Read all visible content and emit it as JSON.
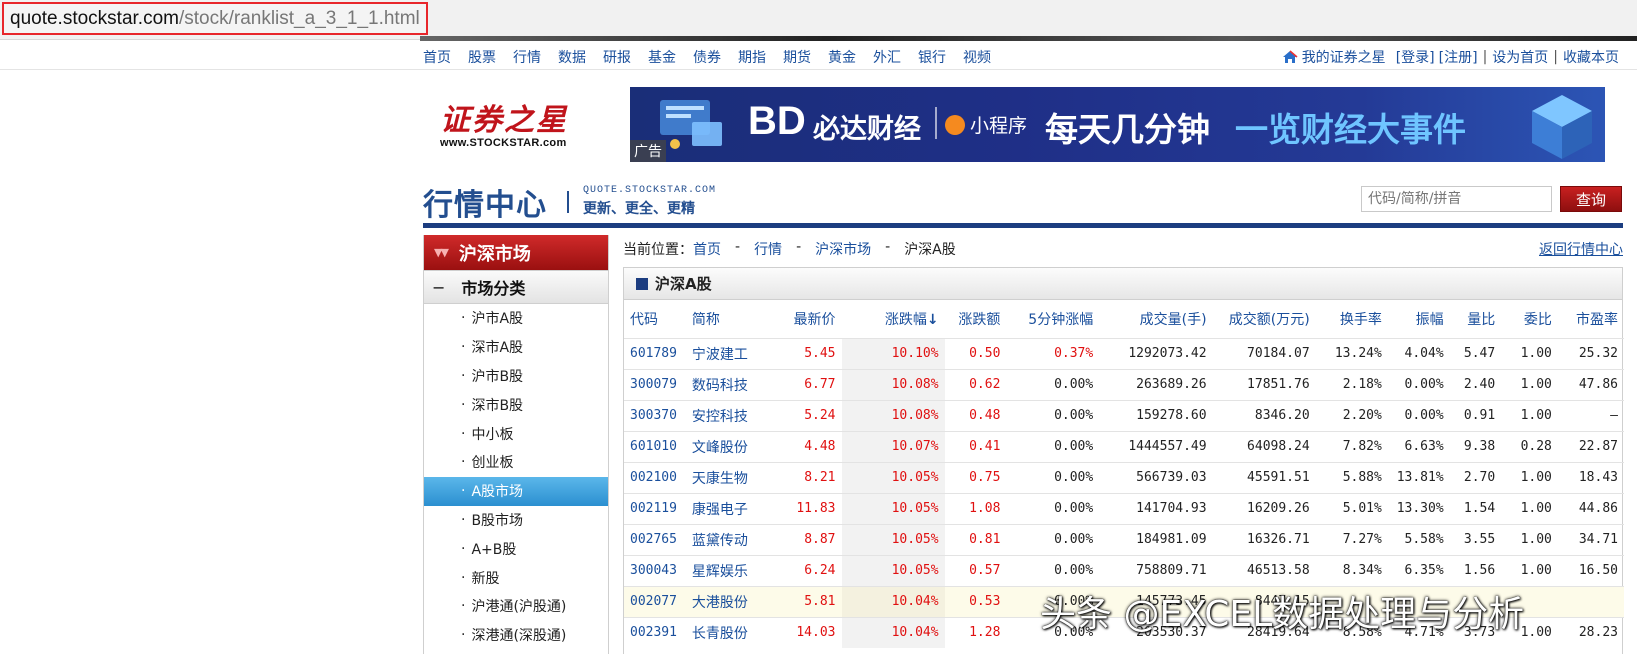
{
  "url": {
    "host": "quote.stockstar.com",
    "path": "/stock/ranklist_a_3_1_1.html"
  },
  "topnav": {
    "links": [
      "首页",
      "股票",
      "行情",
      "数据",
      "研报",
      "基金",
      "债券",
      "期指",
      "期货",
      "黄金",
      "外汇",
      "银行",
      "视频"
    ],
    "right": {
      "my": "我的证券之星",
      "login": "[登录]",
      "register": "[注册]",
      "sep": "|",
      "set_home": "设为首页",
      "favorite": "收藏本页"
    }
  },
  "logo": {
    "cn": "证券之星",
    "en": "www.STOCKSTAR.com"
  },
  "banner": {
    "logo": "BD",
    "name": "必达财经",
    "mini": "小程序",
    "slogan1": "每天几分钟",
    "slogan2": "一览财经大事件",
    "ad": "广告"
  },
  "header": {
    "title": "行情中心",
    "sub1": "QUOTE.STOCKSTAR.COM",
    "sub2": "更新、更全、更精",
    "search_placeholder": "代码/简称/拼音",
    "search_button": "查询"
  },
  "sidebar": {
    "title": "沪深市场",
    "section": "市场分类",
    "items": [
      {
        "label": "沪市A股",
        "active": false
      },
      {
        "label": "深市A股",
        "active": false
      },
      {
        "label": "沪市B股",
        "active": false
      },
      {
        "label": "深市B股",
        "active": false
      },
      {
        "label": "中小板",
        "active": false
      },
      {
        "label": "创业板",
        "active": false
      },
      {
        "label": "A股市场",
        "active": true
      },
      {
        "label": "B股市场",
        "active": false
      },
      {
        "label": "A+B股",
        "active": false
      },
      {
        "label": "新股",
        "active": false
      },
      {
        "label": "沪港通(沪股通)",
        "active": false
      },
      {
        "label": "深港通(深股通)",
        "active": false
      }
    ]
  },
  "breadcrumb": {
    "prefix": "当前位置：",
    "items": [
      "首页",
      "行情",
      "沪深市场"
    ],
    "current": "沪深A股",
    "dash": "-",
    "back": "返回行情中心"
  },
  "panel": {
    "title": "沪深A股"
  },
  "table": {
    "headers": [
      "代码",
      "简称",
      "最新价",
      "涨跌幅",
      "涨跌额",
      "5分钟涨幅",
      "成交量(手)",
      "成交额(万元)",
      "换手率",
      "振幅",
      "量比",
      "委比",
      "市盈率"
    ],
    "sort_arrow": "↓",
    "rows": [
      [
        "601789",
        "宁波建工",
        "5.45",
        "10.10%",
        "0.50",
        "0.37%",
        "1292073.42",
        "70184.07",
        "13.24%",
        "4.04%",
        "5.47",
        "1.00",
        "25.32"
      ],
      [
        "300079",
        "数码科技",
        "6.77",
        "10.08%",
        "0.62",
        "0.00%",
        "263689.26",
        "17851.76",
        "2.18%",
        "0.00%",
        "2.40",
        "1.00",
        "47.86"
      ],
      [
        "300370",
        "安控科技",
        "5.24",
        "10.08%",
        "0.48",
        "0.00%",
        "159278.60",
        "8346.20",
        "2.20%",
        "0.00%",
        "0.91",
        "1.00",
        "—"
      ],
      [
        "601010",
        "文峰股份",
        "4.48",
        "10.07%",
        "0.41",
        "0.00%",
        "1444557.49",
        "64098.24",
        "7.82%",
        "6.63%",
        "9.38",
        "0.28",
        "22.87"
      ],
      [
        "002100",
        "天康生物",
        "8.21",
        "10.05%",
        "0.75",
        "0.00%",
        "566739.03",
        "45591.51",
        "5.88%",
        "13.81%",
        "2.70",
        "1.00",
        "18.43"
      ],
      [
        "002119",
        "康强电子",
        "11.83",
        "10.05%",
        "1.08",
        "0.00%",
        "141704.93",
        "16209.26",
        "5.01%",
        "13.30%",
        "1.54",
        "1.00",
        "44.86"
      ],
      [
        "002765",
        "蓝黛传动",
        "8.87",
        "10.05%",
        "0.81",
        "0.00%",
        "184981.09",
        "16326.71",
        "7.27%",
        "5.58%",
        "3.55",
        "1.00",
        "34.71"
      ],
      [
        "300043",
        "星辉娱乐",
        "6.24",
        "10.05%",
        "0.57",
        "0.00%",
        "758809.71",
        "46513.58",
        "8.34%",
        "6.35%",
        "1.56",
        "1.00",
        "16.50"
      ],
      [
        "002077",
        "大港股份",
        "5.81",
        "10.04%",
        "0.53",
        "0.00%",
        "145773.45",
        "8447.15",
        "",
        "",
        "",
        "",
        ""
      ],
      [
        "002391",
        "长青股份",
        "14.03",
        "10.04%",
        "1.28",
        "0.00%",
        "203530.37",
        "28419.64",
        "8.58%",
        "4.71%",
        "3.73",
        "1.00",
        "28.23"
      ]
    ],
    "highlight_row": 8
  },
  "watermark": "头条 @EXCEL数据处理与分析",
  "colors": {
    "link": "#1a4f9c",
    "up": "#e01010",
    "brand": "#c0141b",
    "navy": "#1c3d80",
    "active": "#2b8fd0"
  }
}
